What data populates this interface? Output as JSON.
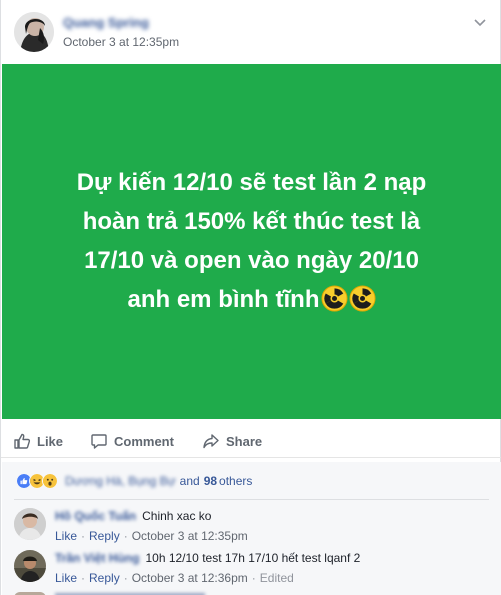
{
  "post": {
    "author": "Quang Spring",
    "timestamp": "October 3 at 12:35pm",
    "status_lines": [
      "Dự kiến 12/10 sẽ test lần 2 nạp",
      "hoàn trả 150% kết thúc test là",
      "17/10 và open vào ngày 20/10",
      "anh em bình tĩnh"
    ],
    "status_bg_color": "#1fab4b",
    "status_emoji_icons": [
      "radioactive-icon",
      "radioactive-icon"
    ]
  },
  "actions": {
    "like": "Like",
    "comment": "Comment",
    "share": "Share"
  },
  "reactions": {
    "icons": [
      "like-reaction-icon",
      "haha-reaction-icon",
      "wow-reaction-icon"
    ],
    "names": "Dương Hà, Bụng Bự",
    "and": "and",
    "count": "98",
    "others": "others"
  },
  "comments": [
    {
      "name": "Hồ Quốc Tuấn",
      "text": "Chinh xac ko",
      "like": "Like",
      "reply": "Reply",
      "time": "October 3 at 12:35pm",
      "edited": ""
    },
    {
      "name": "Trần Việt Hùng",
      "text": "10h 12/10 test 17h 17/10 hết test lqanf 2",
      "like": "Like",
      "reply": "Reply",
      "time": "October 3 at 12:36pm",
      "edited": "Edited"
    }
  ]
}
